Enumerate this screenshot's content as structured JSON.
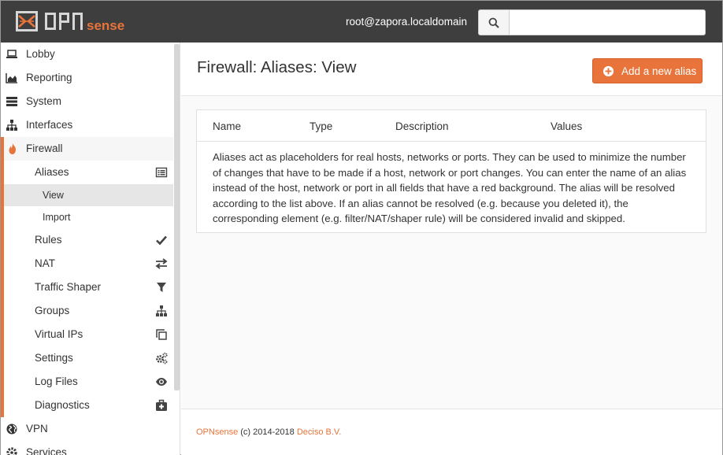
{
  "header": {
    "brand": "OPNsense",
    "user": "root@zapora.localdomain",
    "search": {
      "value": "",
      "placeholder": ""
    }
  },
  "sidebar": {
    "items": [
      {
        "label": "Lobby",
        "icon": "laptop-icon"
      },
      {
        "label": "Reporting",
        "icon": "area-chart-icon"
      },
      {
        "label": "System",
        "icon": "server-icon"
      },
      {
        "label": "Interfaces",
        "icon": "sitemap-icon"
      },
      {
        "label": "Firewall",
        "icon": "fire-icon"
      }
    ],
    "firewall_sub": [
      {
        "label": "Aliases",
        "icon": "list-alt-icon"
      },
      {
        "label": "View"
      },
      {
        "label": "Import"
      },
      {
        "label": "Rules",
        "icon": "check-icon"
      },
      {
        "label": "NAT",
        "icon": "exchange-icon"
      },
      {
        "label": "Traffic Shaper",
        "icon": "filter-icon"
      },
      {
        "label": "Groups",
        "icon": "sitemap-icon"
      },
      {
        "label": "Virtual IPs",
        "icon": "clone-icon"
      },
      {
        "label": "Settings",
        "icon": "cogs-icon"
      },
      {
        "label": "Log Files",
        "icon": "eye-icon"
      },
      {
        "label": "Diagnostics",
        "icon": "medkit-icon"
      }
    ],
    "after": [
      {
        "label": "VPN",
        "icon": "globe-icon"
      },
      {
        "label": "Services",
        "icon": "cog-icon"
      }
    ]
  },
  "main": {
    "title": "Firewall: Aliases: View",
    "add_button": "Add a new alias",
    "columns": [
      "Name",
      "Type",
      "Description",
      "Values"
    ],
    "description": "Aliases act as placeholders for real hosts, networks or ports. They can be used to minimize the number of changes that have to be made if a host, network or port changes. You can enter the name of an alias instead of the host, network or port in all fields that have a red background. The alias will be resolved according to the list above. If an alias cannot be resolved (e.g. because you deleted it), the corresponding element (e.g. filter/NAT/shaper rule) will be considered invalid and skipped."
  },
  "footer": {
    "brand": "OPNsense",
    "copyright": "(c) 2014-2018",
    "company": "Deciso B.V."
  },
  "colors": {
    "accent": "#e8743b",
    "header": "#3e3e3e"
  }
}
